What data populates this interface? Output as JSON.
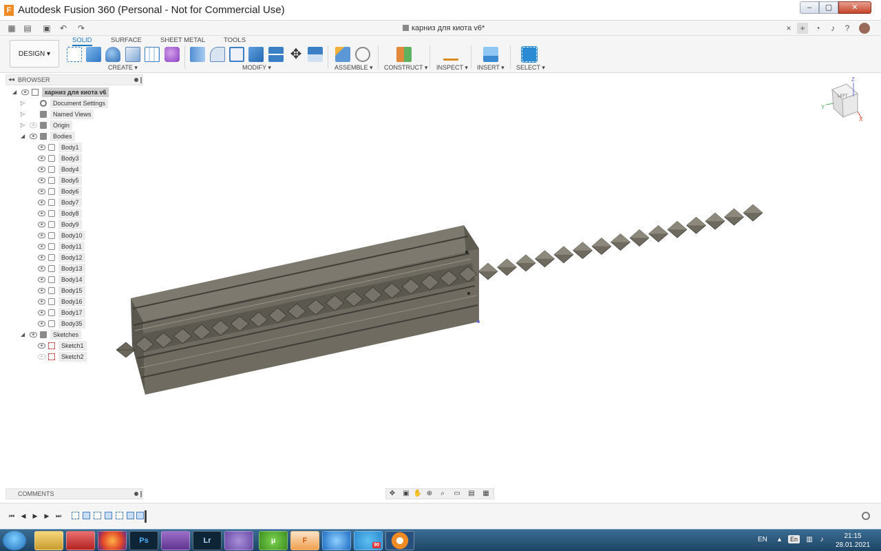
{
  "window": {
    "title": "Autodesk Fusion 360 (Personal - Not for Commercial Use)",
    "app_icon": "F",
    "min_label": "–",
    "max_label": "▢",
    "close_label": "✕"
  },
  "document": {
    "tab_title": "карниз для киота v6*",
    "close_glyph": "×"
  },
  "ribbon": {
    "workspace": "DESIGN ▾",
    "tabs": [
      "SOLID",
      "SURFACE",
      "SHEET METAL",
      "TOOLS"
    ],
    "groups": {
      "create": "CREATE ▾",
      "modify": "MODIFY ▾",
      "assemble": "ASSEMBLE ▾",
      "construct": "CONSTRUCT ▾",
      "inspect": "INSPECT ▾",
      "insert": "INSERT ▾",
      "select": "SELECT ▾"
    }
  },
  "browser": {
    "title": "BROWSER",
    "root": "карниз для киота v6",
    "document_settings": "Document Settings",
    "named_views": "Named Views",
    "origin": "Origin",
    "bodies_label": "Bodies",
    "bodies": [
      "Body1",
      "Body3",
      "Body4",
      "Body5",
      "Body6",
      "Body7",
      "Body8",
      "Body9",
      "Body10",
      "Body11",
      "Body12",
      "Body13",
      "Body14",
      "Body15",
      "Body16",
      "Body17",
      "Body35"
    ],
    "sketches_label": "Sketches",
    "sketches": [
      "Sketch1",
      "Sketch2"
    ]
  },
  "comments": {
    "title": "COMMENTS"
  },
  "viewcube": {
    "face": "LEFT",
    "axis_z": "Z",
    "axis_y": "Y",
    "axis_x": "X"
  },
  "taskbar": {
    "ps_label": "Ps",
    "lr_label": "Lr",
    "ut_label": "µ",
    "fusion_label": "F",
    "telegram_badge": "90",
    "lang": "EN",
    "lang_indicator": "En",
    "time": "21:15",
    "date": "28.01.2021"
  },
  "colors": {
    "accent": "#1a78c2",
    "model_face": "#7a766b",
    "model_dark": "#4e4b43",
    "taskbar": "#2b5a80"
  }
}
